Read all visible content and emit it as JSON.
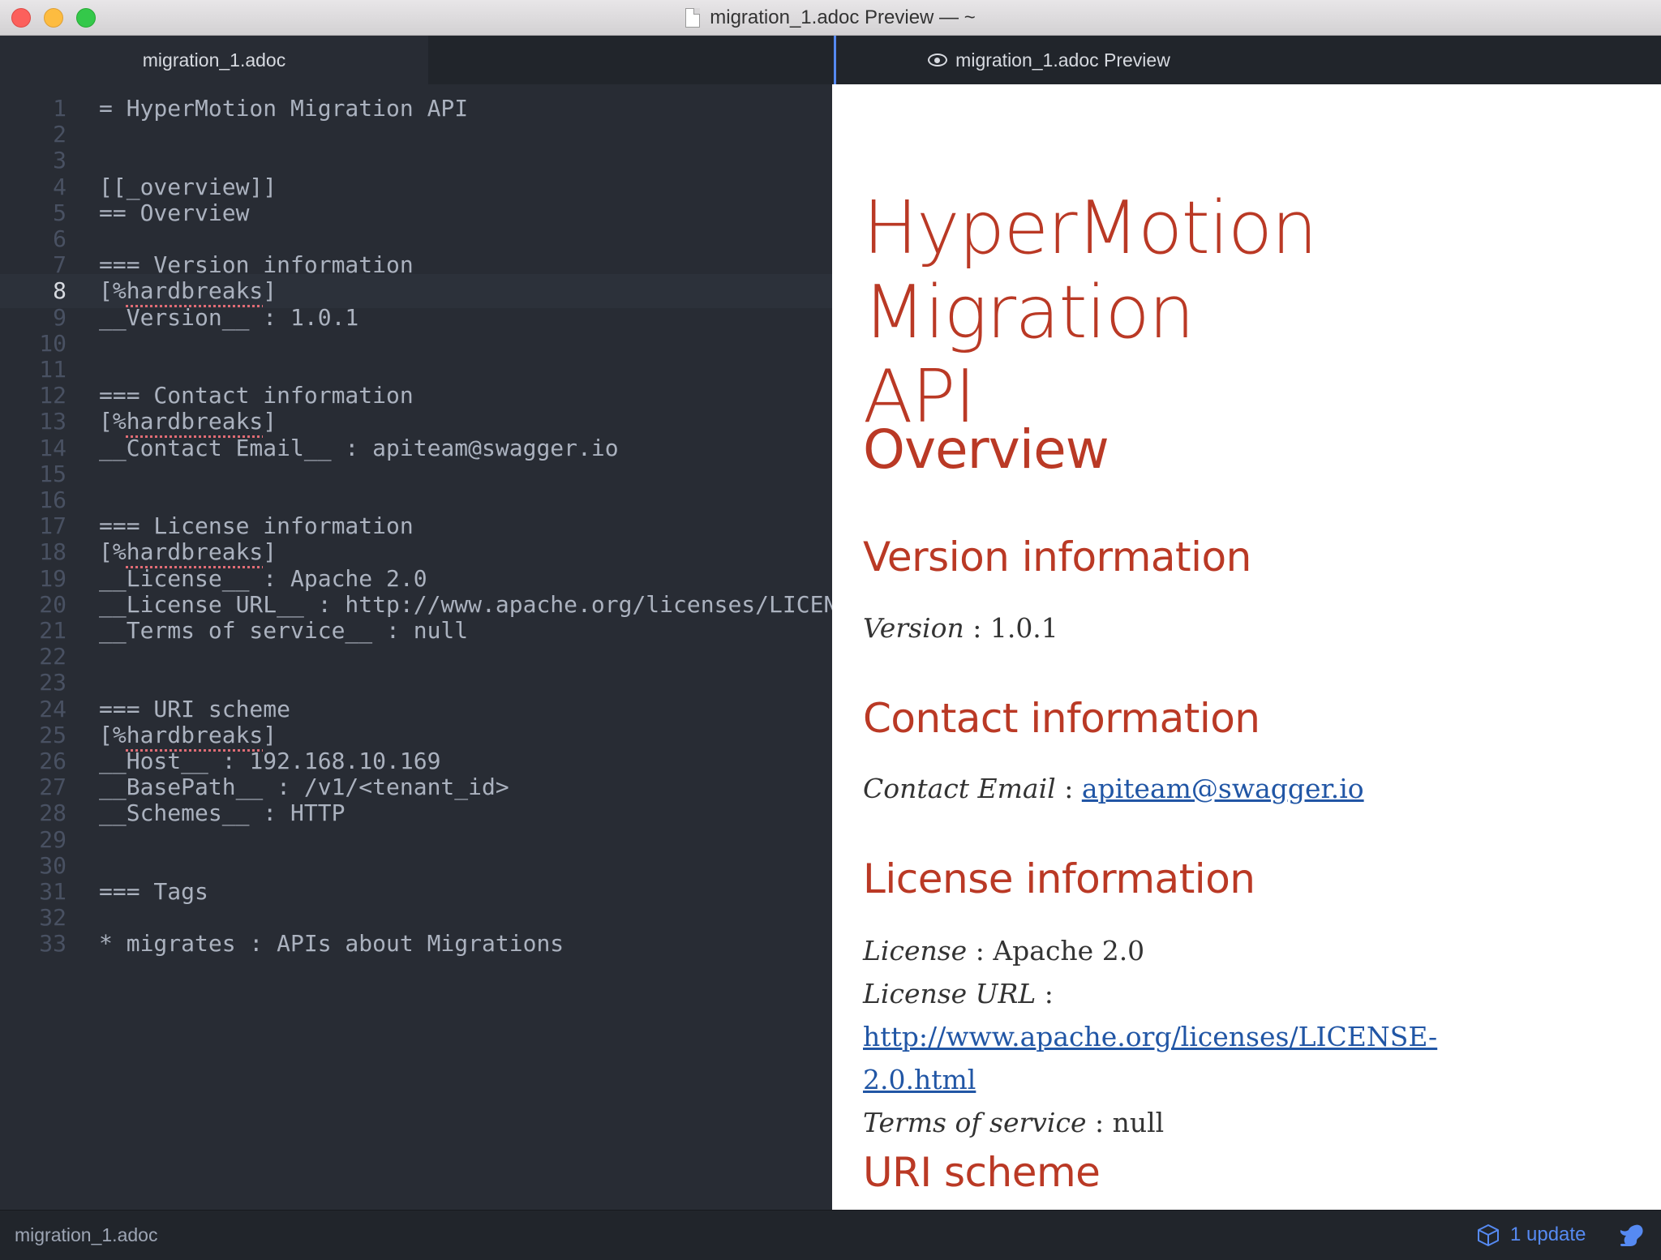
{
  "window": {
    "title": "migration_1.adoc Preview — ~"
  },
  "tabs": [
    {
      "label": "migration_1.adoc"
    },
    {
      "label": "migration_1.adoc Preview"
    }
  ],
  "editor": {
    "active_line": 8,
    "lines": [
      {
        "n": "1",
        "text": "= HyperMotion Migration API"
      },
      {
        "n": "2",
        "text": ""
      },
      {
        "n": "3",
        "text": ""
      },
      {
        "n": "4",
        "text": "[[_overview]]"
      },
      {
        "n": "5",
        "text": "== Overview"
      },
      {
        "n": "6",
        "text": ""
      },
      {
        "n": "7",
        "text": "=== Version information"
      },
      {
        "n": "8",
        "text": "[%hardbreaks]",
        "squiggle": true
      },
      {
        "n": "9",
        "text": "__Version__ : 1.0.1"
      },
      {
        "n": "10",
        "text": ""
      },
      {
        "n": "11",
        "text": ""
      },
      {
        "n": "12",
        "text": "=== Contact information"
      },
      {
        "n": "13",
        "text": "[%hardbreaks]",
        "squiggle": true
      },
      {
        "n": "14",
        "text": "__Contact Email__ : apiteam@swagger.io"
      },
      {
        "n": "15",
        "text": ""
      },
      {
        "n": "16",
        "text": ""
      },
      {
        "n": "17",
        "text": "=== License information"
      },
      {
        "n": "18",
        "text": "[%hardbreaks]",
        "squiggle": true
      },
      {
        "n": "19",
        "text": "__License__ : Apache 2.0"
      },
      {
        "n": "20",
        "text": "__License URL__ : http://www.apache.org/licenses/LICEN"
      },
      {
        "n": "21",
        "text": "__Terms of service__ : null"
      },
      {
        "n": "22",
        "text": ""
      },
      {
        "n": "23",
        "text": ""
      },
      {
        "n": "24",
        "text": "=== URI scheme"
      },
      {
        "n": "25",
        "text": "[%hardbreaks]",
        "squiggle": true
      },
      {
        "n": "26",
        "text": "__Host__ : 192.168.10.169"
      },
      {
        "n": "27",
        "text": "__BasePath__ : /v1/<tenant_id>"
      },
      {
        "n": "28",
        "text": "__Schemes__ : HTTP"
      },
      {
        "n": "29",
        "text": ""
      },
      {
        "n": "30",
        "text": ""
      },
      {
        "n": "31",
        "text": "=== Tags"
      },
      {
        "n": "32",
        "text": ""
      },
      {
        "n": "33",
        "text": "* migrates : APIs about Migrations"
      }
    ]
  },
  "preview": {
    "title_line1": "HyperMotion Migration",
    "title_line2": "API",
    "overview": "Overview",
    "version_heading": "Version information",
    "version_label": "Version",
    "version_sep": " : ",
    "version_value": "1.0.1",
    "contact_heading": "Contact information",
    "contact_label": "Contact Email",
    "contact_sep": " : ",
    "contact_email": "apiteam@swagger.io",
    "license_heading": "License information",
    "license_label": "License",
    "license_sep": " : ",
    "license_value": "Apache 2.0",
    "license_url_label": "License URL",
    "license_url_sep": " : ",
    "license_url_line1": "http://www.apache.org/licenses/LICENSE-",
    "license_url_line2": "2.0.html",
    "terms_label": "Terms of service",
    "terms_sep": " : ",
    "terms_value": "null",
    "uri_heading": "URI scheme"
  },
  "status": {
    "file": "migration_1.adoc",
    "update": "1 update"
  },
  "colors": {
    "heading": "#ba3925",
    "link": "#2156a5",
    "editor_bg": "#282c34",
    "accent": "#568af2"
  }
}
